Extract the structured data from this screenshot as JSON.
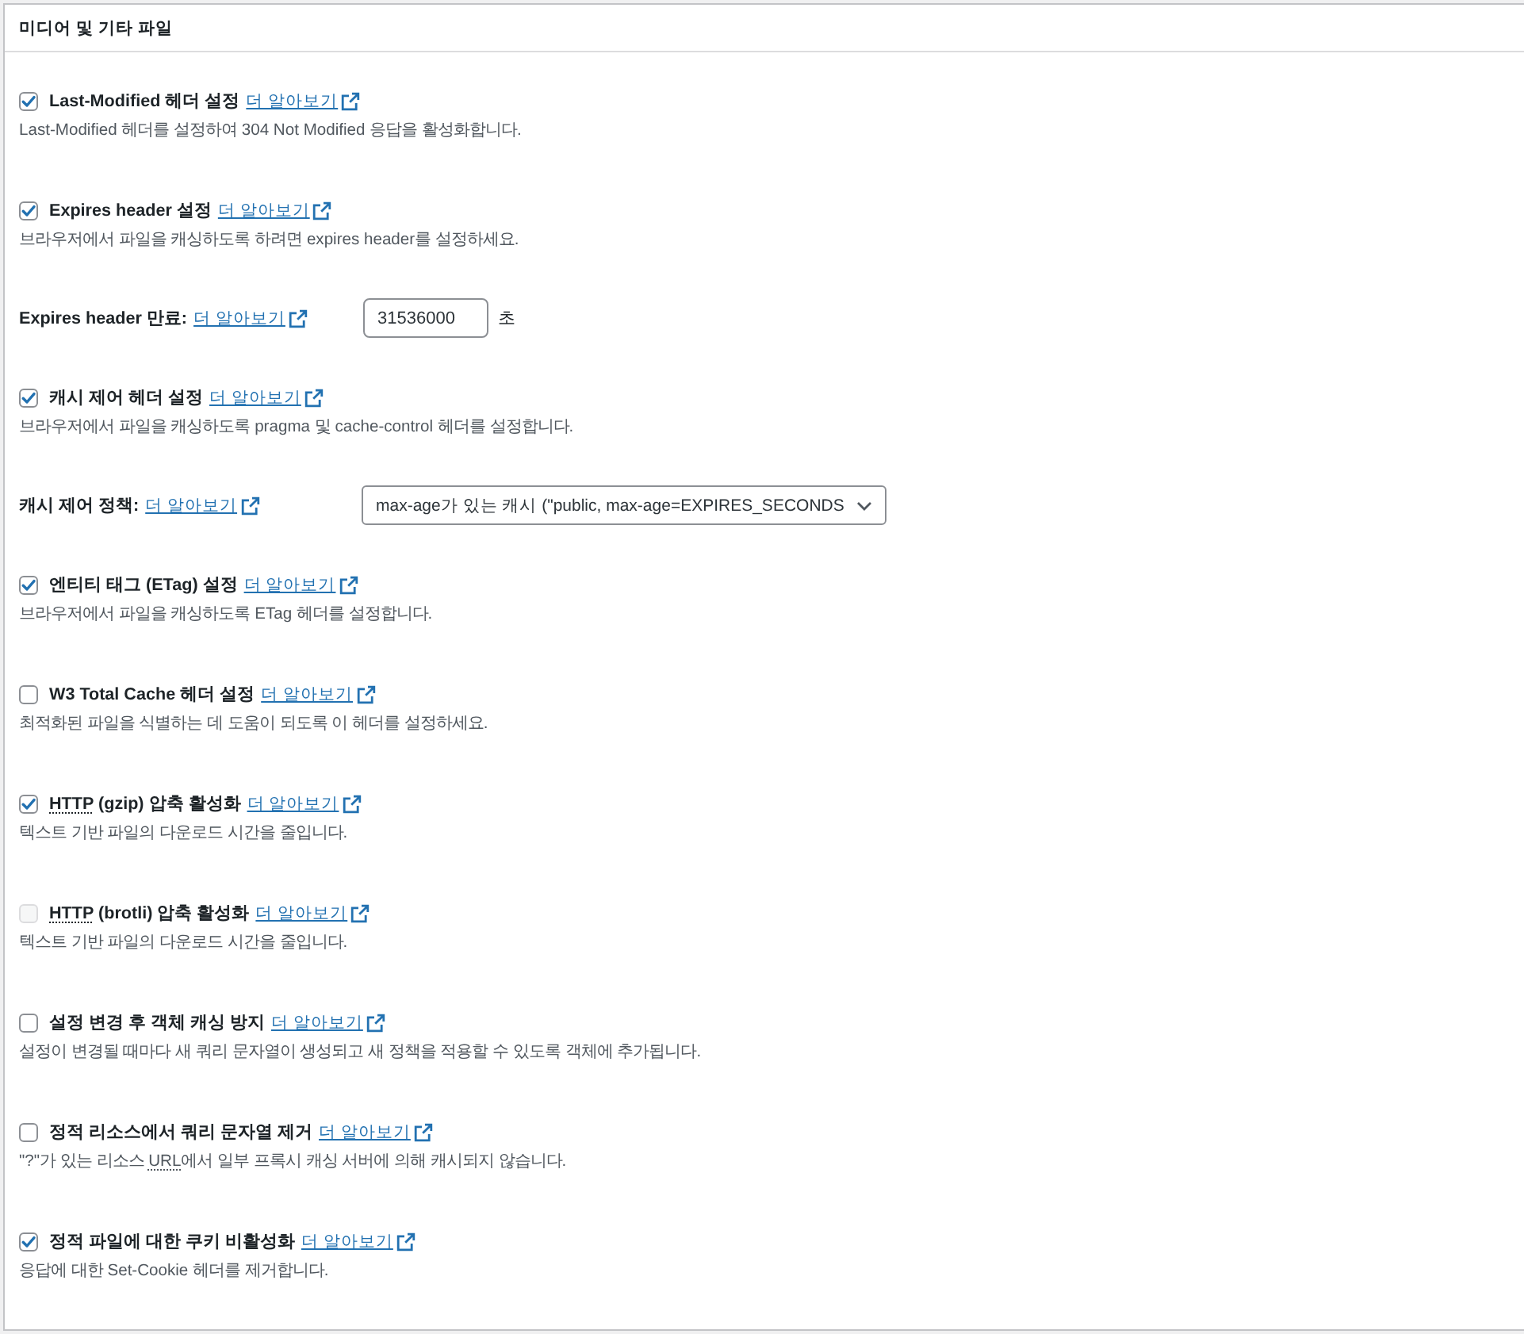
{
  "panel": {
    "title": "미디어 및 기타 파일"
  },
  "settings": [
    {
      "kind": "checkbox",
      "checked": true,
      "disabled": false,
      "label": [
        {
          "text": "Last-Modified 헤더 설정",
          "abbr": false
        }
      ],
      "link": "더 알아보기",
      "description": [
        {
          "text": "Last-Modified 헤더를 설정하여 304 Not Modified 응답을 활성화합니다.",
          "abbr": false
        }
      ]
    },
    {
      "kind": "checkbox",
      "checked": true,
      "disabled": false,
      "label": [
        {
          "text": "Expires header 설정",
          "abbr": false
        }
      ],
      "link": "더 알아보기",
      "description": [
        {
          "text": "브라우저에서 파일을 캐싱하도록 하려면 expires header를 설정하세요.",
          "abbr": false
        }
      ]
    },
    {
      "kind": "number",
      "label": [
        {
          "text": "Expires header 만료:",
          "abbr": false
        }
      ],
      "link": "더 알아보기",
      "value": "31536000",
      "unit": "초"
    },
    {
      "kind": "checkbox",
      "checked": true,
      "disabled": false,
      "label": [
        {
          "text": "캐시 제어 헤더 설정",
          "abbr": false
        }
      ],
      "link": "더 알아보기",
      "description": [
        {
          "text": "브라우저에서 파일을 캐싱하도록 pragma 및 cache-control 헤더를 설정합니다.",
          "abbr": false
        }
      ]
    },
    {
      "kind": "select",
      "label": [
        {
          "text": "캐시 제어 정책:",
          "abbr": false
        }
      ],
      "link": "더 알아보기",
      "value": "max-age가 있는 캐시 (\"public, max-age=EXPIRES_SECONDS"
    },
    {
      "kind": "checkbox",
      "checked": true,
      "disabled": false,
      "label": [
        {
          "text": "엔티티 태그 (ETag) 설정",
          "abbr": false
        }
      ],
      "link": "더 알아보기",
      "description": [
        {
          "text": "브라우저에서 파일을 캐싱하도록 ETag 헤더를 설정합니다.",
          "abbr": false
        }
      ]
    },
    {
      "kind": "checkbox",
      "checked": false,
      "disabled": false,
      "label": [
        {
          "text": "W3 Total Cache 헤더 설정",
          "abbr": false
        }
      ],
      "link": "더 알아보기",
      "description": [
        {
          "text": "최적화된 파일을 식별하는 데 도움이 되도록 이 헤더를 설정하세요.",
          "abbr": false
        }
      ]
    },
    {
      "kind": "checkbox",
      "checked": true,
      "disabled": false,
      "label": [
        {
          "text": "HTTP",
          "abbr": true
        },
        {
          "text": " (gzip) 압축 활성화",
          "abbr": false
        }
      ],
      "link": "더 알아보기",
      "description": [
        {
          "text": "텍스트 기반 파일의 다운로드 시간을 줄입니다.",
          "abbr": false
        }
      ]
    },
    {
      "kind": "checkbox",
      "checked": false,
      "disabled": true,
      "label": [
        {
          "text": "HTTP",
          "abbr": true
        },
        {
          "text": " (brotli) 압축 활성화",
          "abbr": false
        }
      ],
      "link": "더 알아보기",
      "description": [
        {
          "text": "텍스트 기반 파일의 다운로드 시간을 줄입니다.",
          "abbr": false
        }
      ]
    },
    {
      "kind": "checkbox",
      "checked": false,
      "disabled": false,
      "label": [
        {
          "text": "설정 변경 후 객체 캐싱 방지",
          "abbr": false
        }
      ],
      "link": "더 알아보기",
      "description": [
        {
          "text": "설정이 변경될 때마다 새 쿼리 문자열이 생성되고 새 정책을 적용할 수 있도록 객체에 추가됩니다.",
          "abbr": false
        }
      ]
    },
    {
      "kind": "checkbox",
      "checked": false,
      "disabled": false,
      "label": [
        {
          "text": "정적 리소스에서 쿼리 문자열 제거",
          "abbr": false
        }
      ],
      "link": "더 알아보기",
      "description": [
        {
          "text": "\"?\"가 있는 리소스 ",
          "abbr": false
        },
        {
          "text": "URL",
          "abbr": true
        },
        {
          "text": "에서 일부 프록시 캐싱 서버에 의해 캐시되지 않습니다.",
          "abbr": false
        }
      ]
    },
    {
      "kind": "checkbox",
      "checked": true,
      "disabled": false,
      "label": [
        {
          "text": "정적 파일에 대한 쿠키 비활성화",
          "abbr": false
        }
      ],
      "link": "더 알아보기",
      "description": [
        {
          "text": "응답에 대한 Set-Cookie 헤더를 제거합니다.",
          "abbr": false
        }
      ]
    }
  ]
}
